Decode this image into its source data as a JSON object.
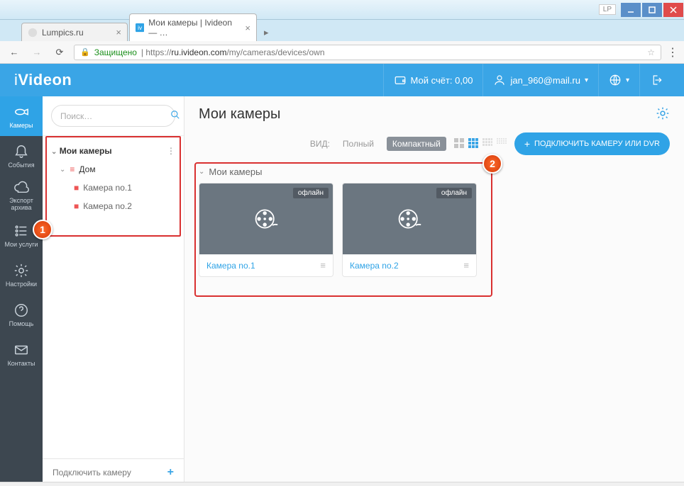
{
  "window": {
    "tag": "LP"
  },
  "tabs": {
    "t1": "Lumpics.ru",
    "t2": "Мои камеры | Ivideon — …"
  },
  "addr": {
    "secure": "Защищено",
    "scheme": "https://",
    "host": "ru.ivideon.com",
    "path": "/my/cameras/devices/own"
  },
  "brand": "iVideon",
  "header": {
    "balance_label": "Мой счёт: 0,00",
    "user": "jan_960@mail.ru"
  },
  "leftnav": {
    "cameras": "Камеры",
    "events": "События",
    "export": "Экспорт архива",
    "services": "Мои услуги",
    "settings": "Настройки",
    "help": "Помощь",
    "contacts": "Контакты"
  },
  "side": {
    "search_ph": "Поиск…",
    "root": "Мои камеры",
    "home": "Дом",
    "cam1": "Камера no.1",
    "cam2": "Камера no.2",
    "connect": "Подключить камеру"
  },
  "markers": {
    "m1": "1",
    "m2": "2"
  },
  "main": {
    "title": "Мои камеры",
    "view_label": "ВИД:",
    "view_full": "Полный",
    "view_compact": "Компактный",
    "connect_btn": "ПОДКЛЮЧИТЬ КАМЕРУ ИЛИ DVR",
    "group": "Мои камеры",
    "offline": "офлайн"
  },
  "cards": [
    {
      "name": "Камера no.1"
    },
    {
      "name": "Камера no.2"
    }
  ]
}
